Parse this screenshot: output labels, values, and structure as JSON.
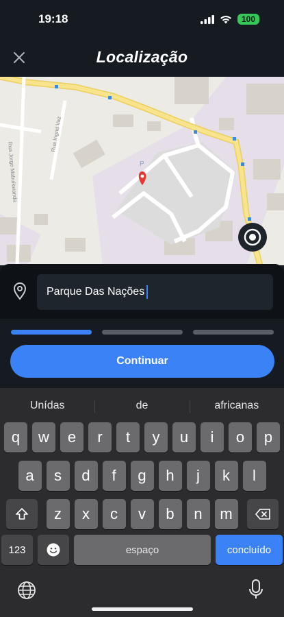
{
  "status": {
    "time": "19:18",
    "battery": "100"
  },
  "header": {
    "title": "Localização"
  },
  "map": {
    "street_1": "Rua Ingrid Vaz",
    "street_2": "Rua Jorge Mabuikwanda",
    "parking_label": "P",
    "colors": {
      "road": "#f4e38a",
      "park": "#e4dde7",
      "building": "#d7d2c9",
      "pin": "#e53935"
    }
  },
  "search": {
    "value": "Parque Das Nações"
  },
  "progress": {
    "steps_total": 3,
    "current_step": 1
  },
  "continue_label": "Continuar",
  "keyboard": {
    "suggestions": [
      "Unídas",
      "de",
      "africanas"
    ],
    "row1": [
      "q",
      "w",
      "e",
      "r",
      "t",
      "y",
      "u",
      "i",
      "o",
      "p"
    ],
    "row2": [
      "a",
      "s",
      "d",
      "f",
      "g",
      "h",
      "j",
      "k",
      "l"
    ],
    "row3": [
      "z",
      "x",
      "c",
      "v",
      "b",
      "n",
      "m"
    ],
    "numbers_label": "123",
    "space_label": "espaço",
    "done_label": "concluído"
  },
  "accent": "#3b82f6"
}
